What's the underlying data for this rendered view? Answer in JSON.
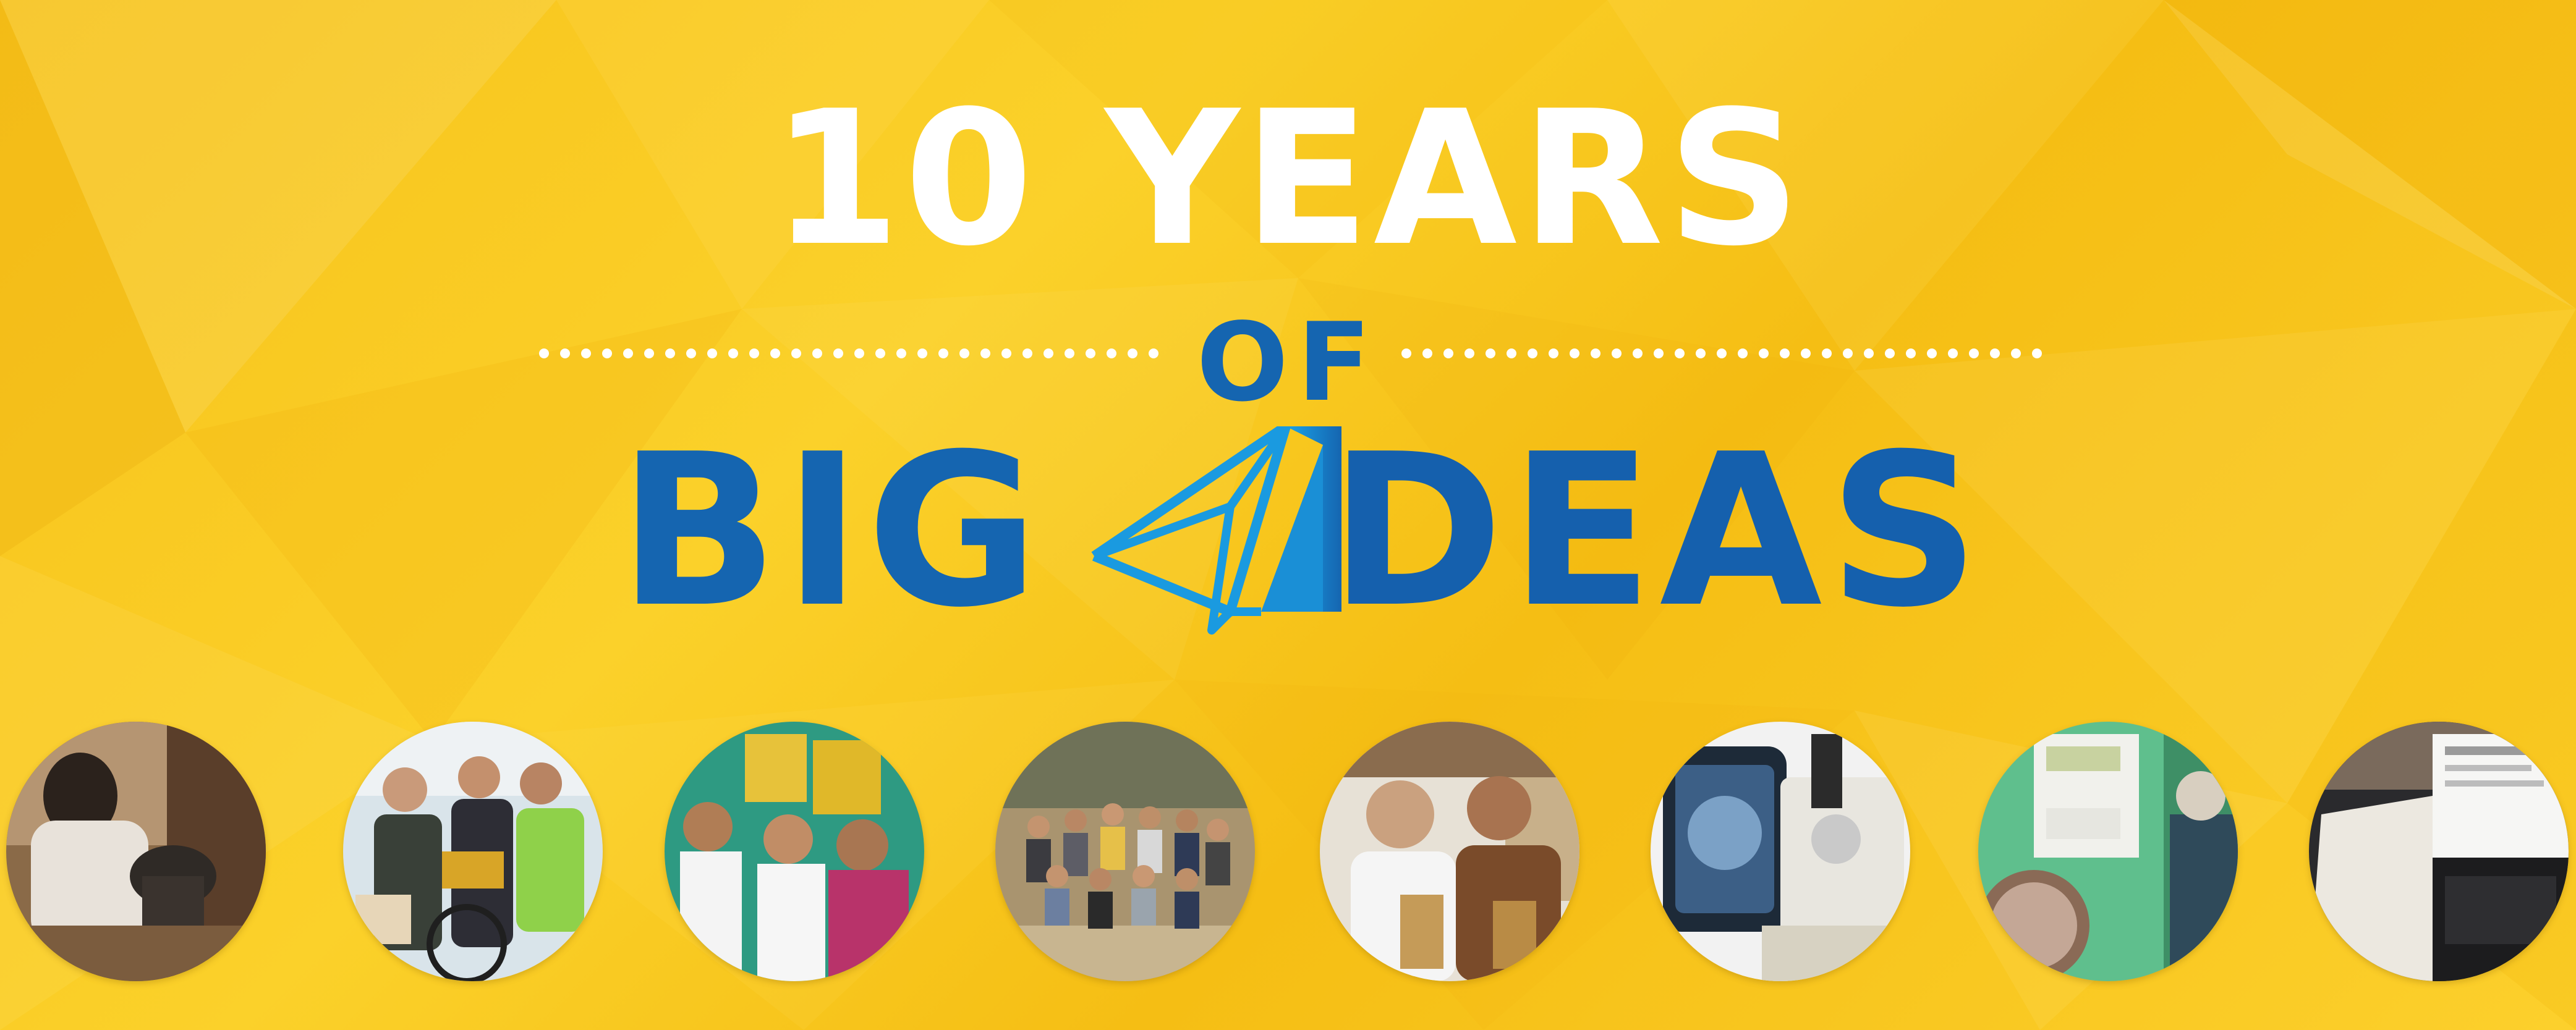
{
  "banner": {
    "headline_line1": "10 YEARS",
    "headline_line2": "OF",
    "headline_word_left": "BIG",
    "headline_word_right": "DEAS",
    "logo_icon": "paper-plane-icon",
    "colors": {
      "background": "#f9c81e",
      "headline_white": "#ffffff",
      "headline_blue": "#1565b0",
      "plane_blue": "#1a8fd6"
    }
  },
  "photos": [
    {
      "subject": "cooking-stove-photo"
    },
    {
      "subject": "cyclists-group-photo"
    },
    {
      "subject": "medical-staff-photo"
    },
    {
      "subject": "large-team-photo"
    },
    {
      "subject": "two-founders-photo"
    },
    {
      "subject": "microscope-device-photo"
    },
    {
      "subject": "electrical-meter-photo"
    },
    {
      "subject": "laptop-notebook-photo"
    }
  ]
}
